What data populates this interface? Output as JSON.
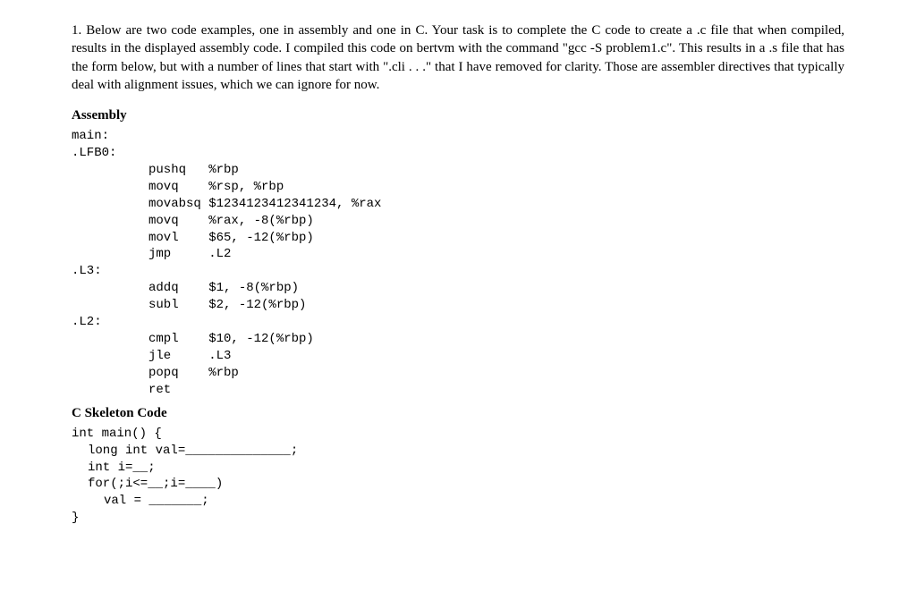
{
  "question_number": "1.",
  "intro": "Below are two code examples, one in assembly and one in C. Your task is to complete the C code to create a .c file that when compiled, results in the displayed assembly code. I compiled this code on bertvm with the command \"gcc -S problem1.c\". This results in a .s file that has the form below, but with a number of lines that start with \".cli . . .\" that I have removed for clarity. Those are assembler directives that typically deal with alignment issues, which we can ignore for now.",
  "assembly_header": "Assembly",
  "asm": {
    "l0": "main:",
    "l1": ".LFB0:",
    "i0": "pushq   %rbp",
    "i1": "movq    %rsp, %rbp",
    "i2": "movabsq $1234123412341234, %rax",
    "i3": "movq    %rax, -8(%rbp)",
    "i4": "movl    $65, -12(%rbp)",
    "i5": "jmp     .L2",
    "l2": ".L3:",
    "i6": "addq    $1, -8(%rbp)",
    "i7": "subl    $2, -12(%rbp)",
    "l3": ".L2:",
    "i8": "cmpl    $10, -12(%rbp)",
    "i9": "jle     .L3",
    "i10": "popq    %rbp",
    "i11": "ret"
  },
  "c_header": "C Skeleton Code",
  "c": {
    "l0": "int main() {",
    "l1": "long int val=______________;",
    "l2": "int i=__;",
    "l3": "for(;i<=__;i=____)",
    "l4": "val = _______;",
    "l5": "}"
  }
}
